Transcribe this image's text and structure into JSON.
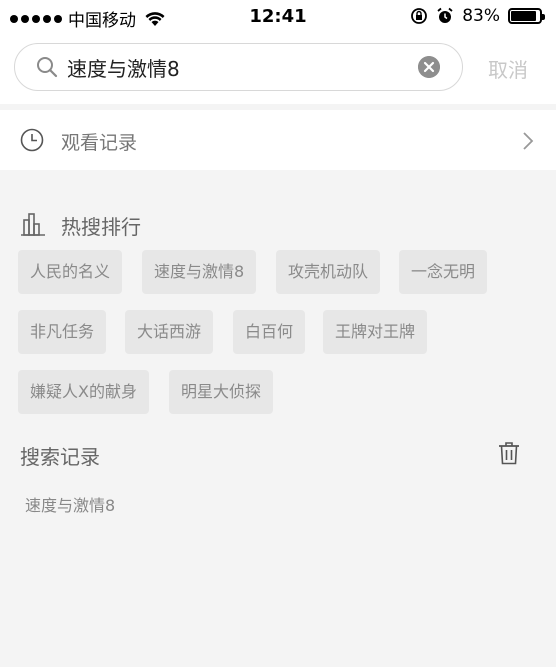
{
  "status_bar": {
    "carrier": "中国移动",
    "time": "12:41",
    "battery_percent": "83%",
    "battery_level": 0.83
  },
  "search": {
    "query": "速度与激情8",
    "clear_icon": "clear-circle-icon",
    "cancel_label": "取消"
  },
  "history": {
    "label": "观看记录",
    "icon": "clock-icon"
  },
  "hot": {
    "title": "热搜排行",
    "icon": "bar-chart-icon",
    "tags": [
      "人民的名义",
      "速度与激情8",
      "攻壳机动队",
      "一念无明",
      "非凡任务",
      "大话西游",
      "白百何",
      "王牌对王牌",
      "嫌疑人X的献身",
      "明星大侦探"
    ]
  },
  "records": {
    "title": "搜索记录",
    "items": [
      "速度与激情8"
    ]
  },
  "colors": {
    "background": "#f4f4f4",
    "tag_background": "#e7e7e7",
    "tag_text": "#8a8a8a",
    "cancel_text": "#c8c8c8"
  }
}
